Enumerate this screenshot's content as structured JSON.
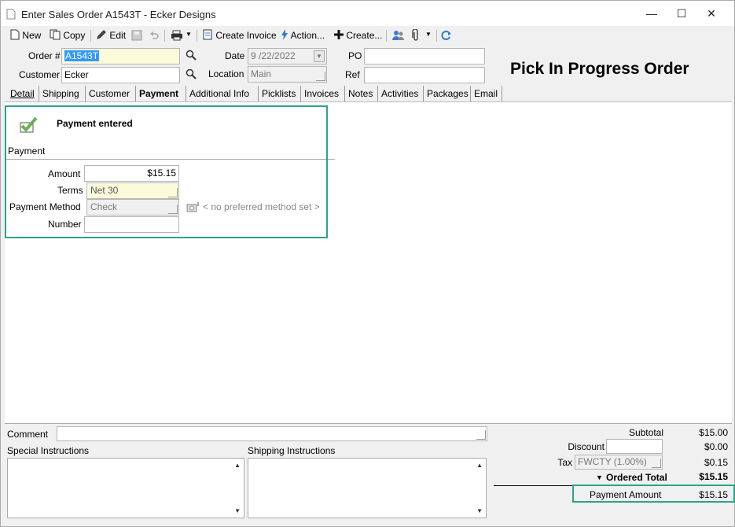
{
  "window": {
    "title": "Enter Sales Order A1543T - Ecker Designs",
    "minimize": "—",
    "maximize": "☐",
    "close": "✕"
  },
  "toolbar": {
    "new": "New",
    "copy": "Copy",
    "edit": "Edit",
    "create_invoice": "Create Invoice",
    "action": "Action...",
    "create": "Create..."
  },
  "header": {
    "order_label": "Order #",
    "order_value": "A1543T",
    "customer_label": "Customer",
    "customer_value": "Ecker",
    "date_label": "Date",
    "date_value": "9 /22/2022",
    "location_label": "Location",
    "location_value": "Main",
    "po_label": "PO",
    "po_value": "",
    "ref_label": "Ref",
    "ref_value": "",
    "banner": "Pick In Progress Order"
  },
  "tabs": [
    {
      "label": "Detail"
    },
    {
      "label": "Shipping"
    },
    {
      "label": "Customer"
    },
    {
      "label": "Payment"
    },
    {
      "label": "Additional Info"
    },
    {
      "label": "Picklists"
    },
    {
      "label": "Invoices"
    },
    {
      "label": "Notes"
    },
    {
      "label": "Activities"
    },
    {
      "label": "Packages"
    },
    {
      "label": "Email"
    }
  ],
  "payment": {
    "status": "Payment entered",
    "section": "Payment",
    "amount_label": "Amount",
    "amount_value": "$15.15",
    "terms_label": "Terms",
    "terms_value": "Net 30",
    "method_label": "Payment Method",
    "method_value": "Check",
    "method_hint": "< no preferred method set >",
    "number_label": "Number",
    "number_value": ""
  },
  "footer": {
    "comment_label": "Comment",
    "special_label": "Special Instructions",
    "shipping_label": "Shipping Instructions",
    "subtotal_label": "Subtotal",
    "subtotal_value": "$15.00",
    "discount_label": "Discount",
    "discount_value": "$0.00",
    "tax_label": "Tax",
    "tax_code": "FWCTY (1.00%)",
    "tax_value": "$0.15",
    "ordered_total_label": "Ordered Total",
    "ordered_total_value": "$15.15",
    "payment_amount_label": "Payment Amount",
    "payment_amount_value": "$15.15"
  },
  "colors": {
    "highlight": "#2aa38a",
    "selection": "#3399ff",
    "check": "#6ab04c"
  },
  "icons": [
    "document-icon",
    "copy-icon",
    "pencil-icon",
    "save-icon",
    "undo-icon",
    "print-icon",
    "invoice-icon",
    "lightning-icon",
    "plus-icon",
    "users-icon",
    "paperclip-icon",
    "refresh-icon",
    "search-icon",
    "check-icon",
    "camera-icon"
  ]
}
